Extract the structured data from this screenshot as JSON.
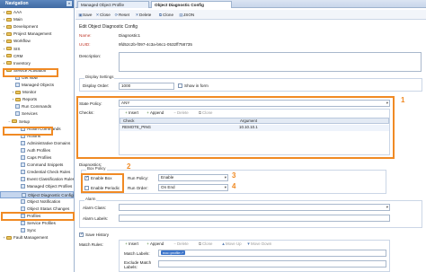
{
  "nav": {
    "title": "Navigation",
    "items": [
      {
        "label": "AAA",
        "kind": "folder",
        "toggle": "+"
      },
      {
        "label": "Main",
        "kind": "folder",
        "toggle": "+"
      },
      {
        "label": "Development",
        "kind": "folder",
        "toggle": "+"
      },
      {
        "label": "Project Management",
        "kind": "folder",
        "toggle": "+"
      },
      {
        "label": "Workflow",
        "kind": "folder",
        "toggle": "+"
      },
      {
        "label": "SIS",
        "kind": "folder",
        "toggle": "+"
      },
      {
        "label": "CRM",
        "kind": "folder",
        "toggle": "+"
      },
      {
        "label": "Inventory",
        "kind": "folder",
        "toggle": "+"
      },
      {
        "label": "Service Activation",
        "kind": "folder",
        "toggle": "−"
      },
      {
        "label": "Get Now",
        "kind": "leaf"
      },
      {
        "label": "Managed Objects",
        "kind": "leaf"
      },
      {
        "label": "Monitor",
        "kind": "folder",
        "toggle": "+"
      },
      {
        "label": "Reports",
        "kind": "folder",
        "toggle": "+"
      },
      {
        "label": "Run Commands",
        "kind": "leaf"
      },
      {
        "label": "Services",
        "kind": "leaf"
      },
      {
        "label": "Setup",
        "kind": "folder",
        "toggle": "−"
      },
      {
        "label": "Action Commands",
        "kind": "leaf"
      },
      {
        "label": "Actions",
        "kind": "leaf"
      },
      {
        "label": "Administrative Domains",
        "kind": "leaf"
      },
      {
        "label": "Auth Profiles",
        "kind": "leaf"
      },
      {
        "label": "Caps Profiles",
        "kind": "leaf"
      },
      {
        "label": "Command Snippets",
        "kind": "leaf"
      },
      {
        "label": "Credential Check Rules",
        "kind": "leaf"
      },
      {
        "label": "Event Classification Rules",
        "kind": "leaf"
      },
      {
        "label": "Managed Object Profiles",
        "kind": "leaf"
      },
      {
        "label": "Object Diagnostic Configs",
        "kind": "leaf",
        "selected": true
      },
      {
        "label": "Object Notification",
        "kind": "leaf"
      },
      {
        "label": "Object Status Changes",
        "kind": "leaf"
      },
      {
        "label": "Profiles",
        "kind": "leaf"
      },
      {
        "label": "Service Profiles",
        "kind": "leaf"
      },
      {
        "label": "Sync",
        "kind": "leaf"
      },
      {
        "label": "Fault Management",
        "kind": "folder",
        "toggle": "+"
      }
    ]
  },
  "tabs": [
    {
      "label": "Managed Object Profile"
    },
    {
      "label": "Object Diagnostic Config",
      "active": true
    }
  ],
  "toolbar": {
    "save": "Save",
    "close": "Close",
    "reset": "Reset",
    "delete": "Delete",
    "clone": "Clone",
    "json": "JSON"
  },
  "form": {
    "title": "Edit Object Diagnostic Config",
    "name_label": "Name:",
    "name_value": "Diagnostic1",
    "uuid_label": "UUID:",
    "uuid_value": "9fd52c2b-f097-4c3a-b6c1-0532ff758735",
    "description_label": "Description:",
    "display_settings_title": "Display Settings",
    "display_order_label": "Display Order:",
    "display_order_value": "1000",
    "show_in_form_label": "Show in form",
    "state_policy_label": "State Policy:",
    "state_policy_value": "ANY",
    "checks_label": "Checks:",
    "checks_toolbar": {
      "insert": "Insert",
      "append": "Append",
      "delete": "Delete",
      "clone": "Clone"
    },
    "checks_columns": [
      "Check",
      "Argument"
    ],
    "checks_rows": [
      [
        "REMOTE_PING",
        "10.10.10.1"
      ]
    ],
    "diagnostics_label": "Diagnostics:",
    "box_title": "Box Policy",
    "enable_box_label": "Enable Box",
    "box_run_policy_label": "Run Policy:",
    "box_run_policy_value": "Enable",
    "enable_periodic_label": "Enable Periodic",
    "periodic_run_order_label": "Run Order:",
    "periodic_run_order_value": "On End",
    "alarm_title": "Alarm",
    "alarm_class_label": "Alarm Class:",
    "alarm_labels_label": "Alarm Labels:",
    "save_history_label": "Save History",
    "match_rules_label": "Match Rules:",
    "match_toolbar": {
      "insert": "Insert",
      "append": "Append",
      "delete": "Delete",
      "clone": "Clone",
      "move_up": "Move Up",
      "move_down": "Move Down"
    },
    "match_labels_label": "Match Labels:",
    "match_labels_tag": "noc::profile::*",
    "exclude_match_labels_label": "Exclude Match Labels:"
  },
  "callouts": [
    "1",
    "2",
    "3",
    "4"
  ],
  "colors": {
    "highlight": "#f08a24",
    "header": "#4a78b5",
    "selection": "#c5d6ee"
  }
}
